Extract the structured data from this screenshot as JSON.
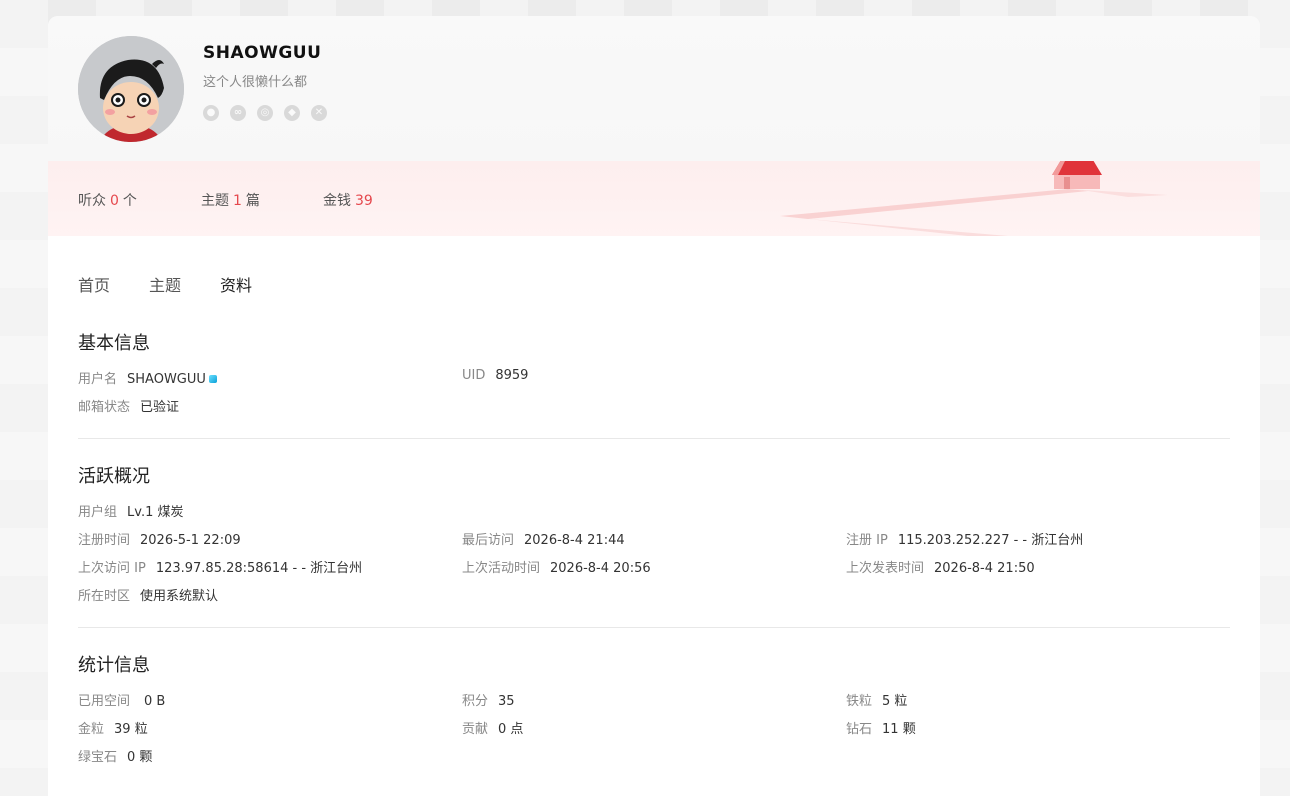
{
  "profile": {
    "username": "SHAOWGUU",
    "signature": "这个人很懒什么都",
    "social_icons": [
      "qq-icon",
      "weibo-icon",
      "wechat-icon",
      "github-icon",
      "xbox-icon"
    ]
  },
  "stats": [
    {
      "label": "听众",
      "value": "0",
      "unit": "个"
    },
    {
      "label": "主题",
      "value": "1",
      "unit": "篇"
    },
    {
      "label": "金钱",
      "value": "39",
      "unit": ""
    }
  ],
  "tabs": [
    "首页",
    "主题",
    "资料"
  ],
  "active_tab": "资料",
  "basic": {
    "title": "基本信息",
    "username_label": "用户名",
    "username_value": "SHAOWGUU",
    "uid_label": "UID",
    "uid_value": "8959",
    "email_label": "邮箱状态",
    "email_value": "已验证"
  },
  "activity": {
    "title": "活跃概况",
    "group_label": "用户组",
    "group_value": "Lv.1 煤炭",
    "reg_time_label": "注册时间",
    "reg_time_value": "2026-5-1 22:09",
    "last_visit_label": "最后访问",
    "last_visit_value": "2026-8-4 21:44",
    "reg_ip_label": "注册 IP",
    "reg_ip_value": "115.203.252.227 - - 浙江台州",
    "last_ip_label": "上次访问 IP",
    "last_ip_value": "123.97.85.28:58614 - - 浙江台州",
    "last_active_label": "上次活动时间",
    "last_active_value": "2026-8-4 20:56",
    "last_post_label": "上次发表时间",
    "last_post_value": "2026-8-4 21:50",
    "timezone_label": "所在时区",
    "timezone_value": "使用系统默认"
  },
  "statistics": {
    "title": "统计信息",
    "space_label": "已用空间",
    "space_value": "0 B",
    "points_label": "积分",
    "points_value": "35",
    "iron_label": "铁粒",
    "iron_value": "5 粒",
    "gold_label": "金粒",
    "gold_value": "39 粒",
    "contrib_label": "贡献",
    "contrib_value": "0 点",
    "diamond_label": "钻石",
    "diamond_value": "11 颗",
    "emerald_label": "绿宝石",
    "emerald_value": "0 颗"
  },
  "colors": {
    "accent": "#e5484d",
    "house_roof": "#e0343a",
    "house_wall": "#f7b9b9"
  }
}
